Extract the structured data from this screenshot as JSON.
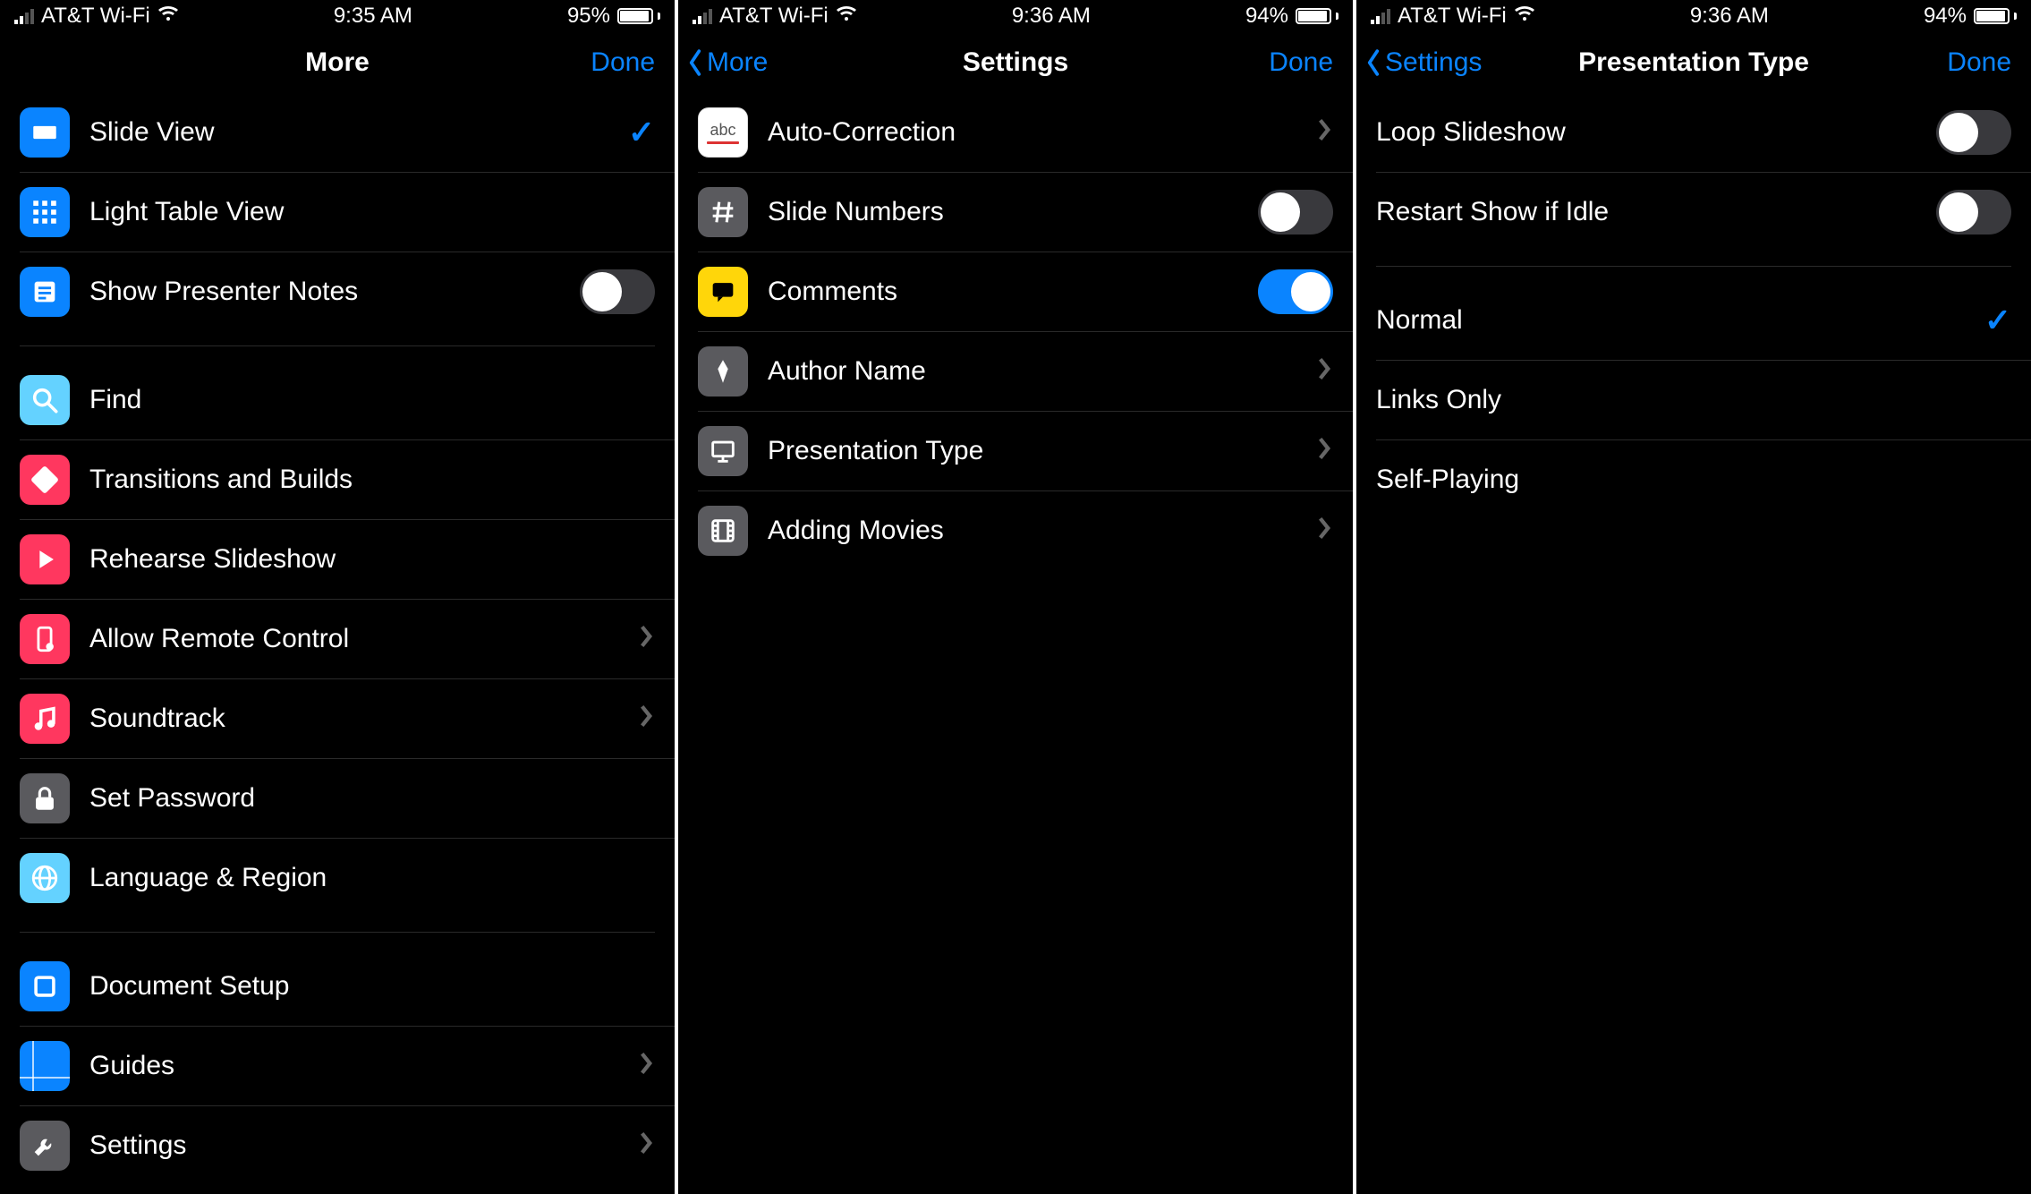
{
  "statusbar": {
    "carrier": "AT&T Wi-Fi"
  },
  "panels": [
    {
      "time": "9:35 AM",
      "battery_text": "95%",
      "battery_fill": 95,
      "back_label": null,
      "title": "More",
      "done": "Done",
      "groups": [
        [
          {
            "id": "slide-view",
            "label": "Slide View",
            "icon": "slide-view-icon",
            "color": "blue",
            "accessory": "check"
          },
          {
            "id": "light-table-view",
            "label": "Light Table View",
            "icon": "grid-icon",
            "color": "blue",
            "accessory": "none"
          },
          {
            "id": "show-presenter-notes",
            "label": "Show Presenter Notes",
            "icon": "notes-icon",
            "color": "blue",
            "accessory": "toggle-off"
          }
        ],
        [
          {
            "id": "find",
            "label": "Find",
            "icon": "search-icon",
            "color": "cyan",
            "accessory": "none"
          },
          {
            "id": "transitions",
            "label": "Transitions and Builds",
            "icon": "transitions-icon",
            "color": "red",
            "accessory": "none"
          },
          {
            "id": "rehearse",
            "label": "Rehearse Slideshow",
            "icon": "play-icon",
            "color": "red",
            "accessory": "none"
          },
          {
            "id": "remote",
            "label": "Allow Remote Control",
            "icon": "remote-icon",
            "color": "red",
            "accessory": "chevron"
          },
          {
            "id": "soundtrack",
            "label": "Soundtrack",
            "icon": "music-icon",
            "color": "red",
            "accessory": "chevron"
          },
          {
            "id": "password",
            "label": "Set Password",
            "icon": "lock-icon",
            "color": "gray",
            "accessory": "none"
          },
          {
            "id": "language",
            "label": "Language & Region",
            "icon": "globe-icon",
            "color": "cyan",
            "accessory": "none"
          }
        ],
        [
          {
            "id": "docsetup",
            "label": "Document Setup",
            "icon": "doc-icon",
            "color": "blue",
            "accessory": "none"
          },
          {
            "id": "guides",
            "label": "Guides",
            "icon": "guides-icon",
            "color": "blue",
            "accessory": "chevron"
          },
          {
            "id": "settings",
            "label": "Settings",
            "icon": "wrench-icon",
            "color": "gray",
            "accessory": "chevron"
          }
        ]
      ]
    },
    {
      "time": "9:36 AM",
      "battery_text": "94%",
      "battery_fill": 94,
      "back_label": "More",
      "title": "Settings",
      "done": "Done",
      "groups": [
        [
          {
            "id": "autocorrect",
            "label": "Auto-Correction",
            "icon": "abc-icon",
            "color": "white",
            "accessory": "chevron"
          },
          {
            "id": "slidenumbers",
            "label": "Slide Numbers",
            "icon": "hash-icon",
            "color": "gray",
            "accessory": "toggle-off"
          },
          {
            "id": "comments",
            "label": "Comments",
            "icon": "comment-icon",
            "color": "yellow",
            "accessory": "toggle-on"
          },
          {
            "id": "author",
            "label": "Author Name",
            "icon": "pen-icon",
            "color": "gray",
            "accessory": "chevron"
          },
          {
            "id": "ptype",
            "label": "Presentation Type",
            "icon": "presentation-icon",
            "color": "gray",
            "accessory": "chevron"
          },
          {
            "id": "movies",
            "label": "Adding Movies",
            "icon": "film-icon",
            "color": "gray",
            "accessory": "chevron"
          }
        ]
      ]
    },
    {
      "time": "9:36 AM",
      "battery_text": "94%",
      "battery_fill": 94,
      "back_label": "Settings",
      "title": "Presentation Type",
      "done": "Done",
      "groups": [
        [
          {
            "id": "loop",
            "label": "Loop Slideshow",
            "icon": null,
            "accessory": "toggle-off"
          },
          {
            "id": "restart",
            "label": "Restart Show if Idle",
            "icon": null,
            "accessory": "toggle-off"
          }
        ],
        [
          {
            "id": "normal",
            "label": "Normal",
            "icon": null,
            "accessory": "check"
          },
          {
            "id": "linksonly",
            "label": "Links Only",
            "icon": null,
            "accessory": "none"
          },
          {
            "id": "selfplaying",
            "label": "Self-Playing",
            "icon": null,
            "accessory": "none"
          }
        ]
      ]
    }
  ]
}
